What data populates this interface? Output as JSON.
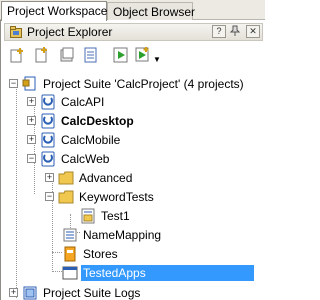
{
  "tabs": [
    {
      "label": "Project Workspace",
      "active": true
    },
    {
      "label": "Object Browser",
      "active": false
    }
  ],
  "explorer": {
    "title": "Project Explorer",
    "title_buttons": [
      "?",
      "pin",
      "x"
    ]
  },
  "toolbar": {
    "buttons": [
      "add-icon",
      "new-item-icon",
      "open-icon",
      "properties-icon",
      "run-icon",
      "run-options-icon"
    ]
  },
  "tree": {
    "suite": {
      "label": "Project Suite 'CalcProject' (4 projects)"
    },
    "projects": [
      {
        "label": "CalcAPI"
      },
      {
        "label": "CalcDesktop",
        "bold": true
      },
      {
        "label": "CalcMobile"
      },
      {
        "label": "CalcWeb"
      }
    ],
    "calcweb_children": [
      {
        "label": "Advanced"
      },
      {
        "label": "KeywordTests"
      },
      {
        "label": "Test1"
      },
      {
        "label": "NameMapping"
      },
      {
        "label": "Stores"
      },
      {
        "label": "TestedApps",
        "selected": true
      }
    ],
    "logs": {
      "label": "Project Suite Logs"
    }
  },
  "colors": {
    "selection": "#3399ff",
    "folder": "#f0c850",
    "project": "#2b5fb4",
    "run": "#2ca02c"
  }
}
